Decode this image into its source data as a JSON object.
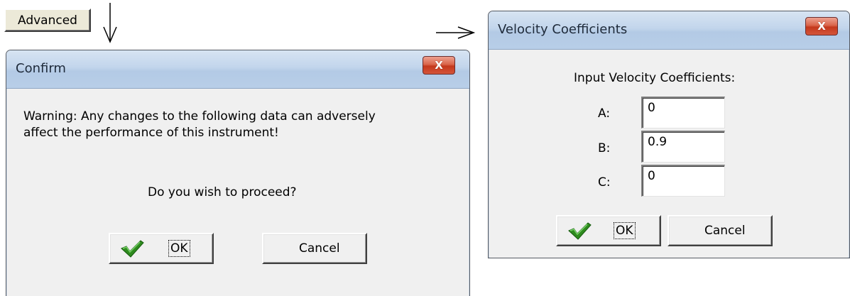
{
  "advanced": {
    "label": "Advanced"
  },
  "confirm": {
    "title": "Confirm",
    "close_glyph": "X",
    "message_line1": "Warning:  Any changes to the following data can adversely",
    "message_line2": "affect the performance of this instrument!",
    "question": "Do you wish to proceed?",
    "ok_label": "OK",
    "cancel_label": "Cancel"
  },
  "velocity": {
    "title": "Velocity Coefficients",
    "close_glyph": "X",
    "heading": "Input Velocity Coefficients:",
    "fields": [
      {
        "label": "A:",
        "value": "0"
      },
      {
        "label": "B:",
        "value": "0.9"
      },
      {
        "label": "C:",
        "value": "0"
      }
    ],
    "ok_label": "OK",
    "cancel_label": "Cancel"
  },
  "icons": {
    "ok_check": "check-icon",
    "down_arrow": "arrow-down-icon",
    "right_arrow": "arrow-right-icon"
  },
  "colors": {
    "title_gradient_top": "#d7e4f2",
    "title_gradient_bottom": "#b8cee8",
    "close_red": "#c4381c",
    "check_green": "#2e8b1e",
    "window_bg": "#f0f0f0"
  }
}
